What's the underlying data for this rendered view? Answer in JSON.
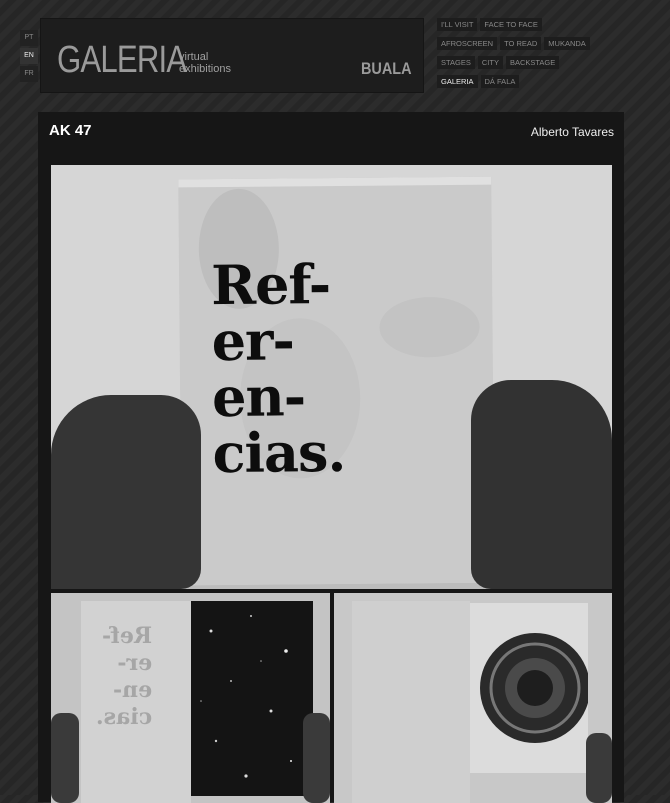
{
  "languages": [
    {
      "label": "PT",
      "active": false
    },
    {
      "label": "EN",
      "active": true
    },
    {
      "label": "FR",
      "active": false
    }
  ],
  "logo": {
    "main": "GALERIA",
    "sub_line1": "virtual",
    "sub_line2": "exhibitions",
    "brand": "BUALA"
  },
  "nav": {
    "row1": [
      "I'LL VISIT",
      "FACE TO FACE"
    ],
    "row2": [
      "AFROSCREEN",
      "TO READ",
      "MUKANDA"
    ],
    "row3": [
      "STAGES",
      "CITY",
      "BACKSTAGE"
    ],
    "row4": [
      "GALERIA",
      "DÁ FALA"
    ],
    "active": "GALERIA"
  },
  "exhibition": {
    "title": "AK 47",
    "author": "Alberto Tavares"
  },
  "book_text": {
    "line1": "Ref-",
    "line2": "er-",
    "line3": "en-",
    "line4": "cias."
  },
  "mirrored_text": {
    "line1": "Ref-",
    "line2": "er-",
    "line3": "en-",
    "line4": "cias."
  }
}
